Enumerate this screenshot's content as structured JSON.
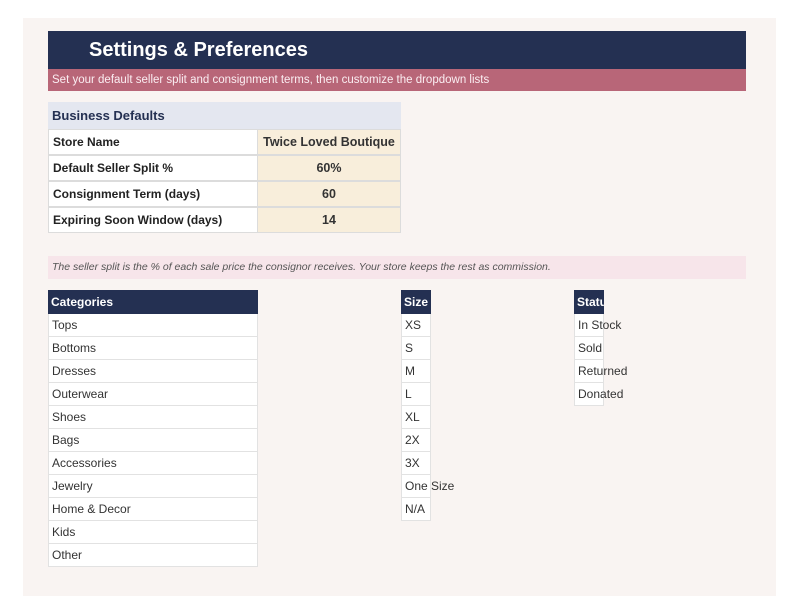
{
  "header": {
    "title": "Settings & Preferences",
    "subtitle": "Set your default seller split and consignment terms, then customize the dropdown lists"
  },
  "business_defaults": {
    "heading": "Business Defaults",
    "rows": [
      {
        "label": "Store Name",
        "value": "Twice Loved Boutique"
      },
      {
        "label": "Default Seller Split %",
        "value": "60%"
      },
      {
        "label": "Consignment Term (days)",
        "value": "60"
      },
      {
        "label": "Expiring Soon Window (days)",
        "value": "14"
      }
    ]
  },
  "note": "The seller split is the % of each sale price the consignor receives. Your store keeps the rest as commission.",
  "lists": {
    "categories": {
      "header": "Categories",
      "items": [
        "Tops",
        "Bottoms",
        "Dresses",
        "Outerwear",
        "Shoes",
        "Bags",
        "Accessories",
        "Jewelry",
        "Home & Decor",
        "Kids",
        "Other"
      ]
    },
    "sizes": {
      "header": "Size",
      "items": [
        "XS",
        "S",
        "M",
        "L",
        "XL",
        "2X",
        "3X",
        "One Size",
        "N/A"
      ]
    },
    "status": {
      "header": "Status",
      "items": [
        "In Stock",
        "Sold",
        "Returned",
        "Donated"
      ]
    }
  },
  "colors": {
    "navy": "#243052",
    "rose": "#b86678",
    "value_fill": "#f8eedb"
  }
}
